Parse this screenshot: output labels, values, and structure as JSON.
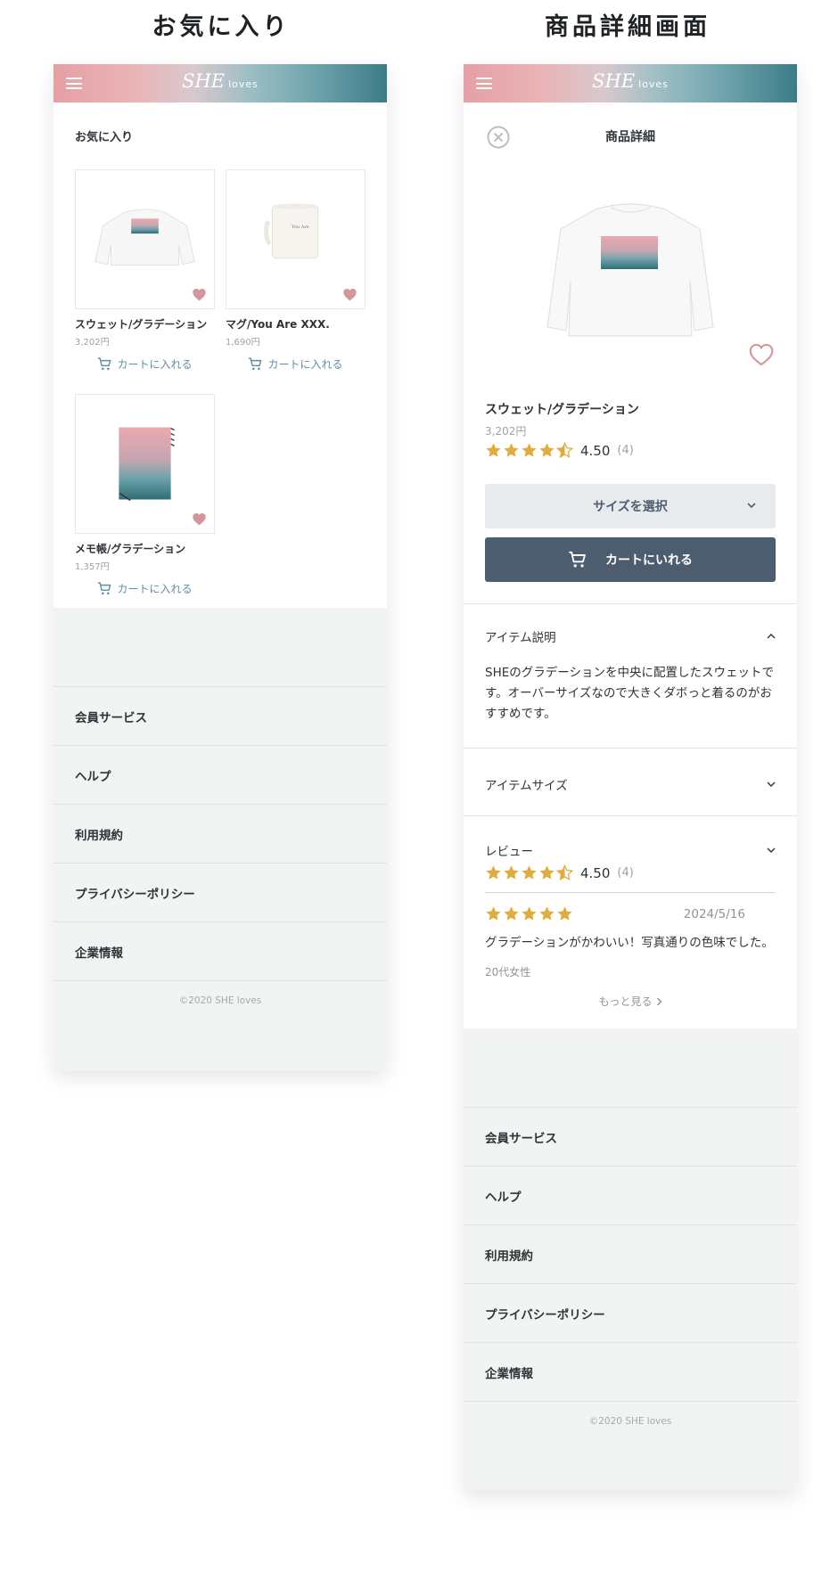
{
  "left_title": "お気に入り",
  "right_title": "商品詳細画面",
  "header": {
    "logo_main": "SHE",
    "logo_sub": "loves"
  },
  "favorites": {
    "heading": "お気に入り",
    "items": [
      {
        "name": "スウェット/グラデーション",
        "price": "3,202円",
        "cart_label": "カートに入れる"
      },
      {
        "name": "マグ/You Are XXX.",
        "price": "1,690円",
        "cart_label": "カートに入れる",
        "mug_text": "You Are"
      },
      {
        "name": "メモ帳/グラデーション",
        "price": "1,357円",
        "cart_label": "カートに入れる"
      }
    ]
  },
  "footer": {
    "links": [
      "会員サービス",
      "ヘルプ",
      "利用規約",
      "プライバシーポリシー",
      "企業情報"
    ],
    "copyright": "©2020 SHE loves"
  },
  "detail": {
    "title": "商品詳細",
    "name": "スウェット/グラデーション",
    "price": "3,202円",
    "rating": 4.5,
    "rating_text": "4.50",
    "rating_count": "(4)",
    "size_label": "サイズを選択",
    "cart_label": "カートにいれる",
    "desc_heading": "アイテム説明",
    "desc_text": "SHEのグラデーションを中央に配置したスウェットです。オーバーサイズなので大きくダボっと着るのがおすすめです。",
    "size_heading": "アイテムサイズ",
    "review_heading": "レビュー",
    "review": {
      "stars": 5,
      "date": "2024/5/16",
      "text": "グラデーションがかわいい！写真通りの色味でした。",
      "reviewer": "20代女性"
    },
    "more_label": "もっと見る"
  },
  "colors": {
    "accent_blue": "#5e8ea5",
    "heart_pink": "#d4969a",
    "star_gold": "#e0ac3e",
    "cart_button": "#4c5d70"
  }
}
